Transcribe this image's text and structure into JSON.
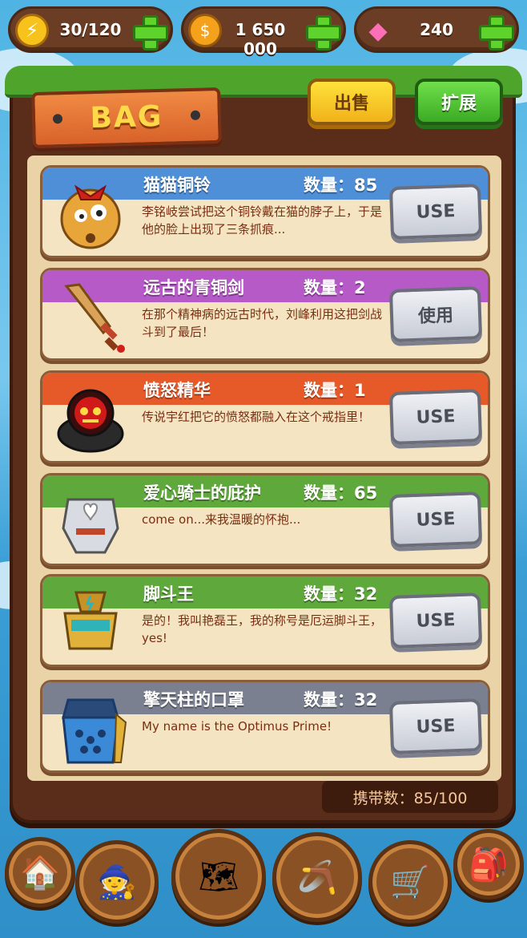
{
  "resources": {
    "energy": {
      "icon": "lightning-icon",
      "value": "30/120",
      "color": "#f7c21c"
    },
    "coins": {
      "icon": "coin-icon",
      "value": "1 650 000",
      "color": "#f4a21c"
    },
    "gems": {
      "icon": "gem-icon",
      "value": "240",
      "color": "#ff6fb8"
    }
  },
  "bag": {
    "title": "BAG",
    "sell_label": "出售",
    "expand_label": "扩展",
    "carry_label": "携带数：85/100"
  },
  "items": [
    {
      "name": "猫猫铜铃",
      "qty": "数量：85",
      "desc": "李铭岐尝试把这个铜铃戴在猫的脖子上，于是他的脸上出现了三条抓痕...",
      "button": "USE",
      "band_color": "#4e8fd8",
      "icon": "cat-bell-icon"
    },
    {
      "name": "远古的青铜剑",
      "qty": "数量：2",
      "desc": "在那个精神病的远古时代，刘峰利用这把剑战斗到了最后！",
      "button": "使用",
      "band_color": "#b65ac8",
      "icon": "bronze-sword-icon"
    },
    {
      "name": "愤怒精华",
      "qty": "数量：1",
      "desc": "传说宇红把它的愤怒都融入在这个戒指里！",
      "button": "USE",
      "band_color": "#e65a2a",
      "icon": "rage-ring-icon"
    },
    {
      "name": "爱心骑士的庇护",
      "qty": "数量：65",
      "desc": "come on...来我温暖的怀抱...",
      "button": "USE",
      "band_color": "#5fa83c",
      "icon": "knight-armor-icon"
    },
    {
      "name": "脚斗王",
      "qty": "数量：32",
      "desc": "是的！我叫艳磊王，我的称号是厄运脚斗王，yes!",
      "button": "USE",
      "band_color": "#5fa83c",
      "icon": "golden-armor-icon"
    },
    {
      "name": "擎天柱的口罩",
      "qty": "数量：32",
      "desc": "My name is the Optimus Prime!",
      "button": "USE",
      "band_color": "#7a8090",
      "icon": "optimus-mask-icon"
    }
  ],
  "nav": [
    {
      "name": "house-icon",
      "glyph": "🏠"
    },
    {
      "name": "wizard-hat-icon",
      "glyph": "🧙"
    },
    {
      "name": "treasure-map-icon",
      "glyph": "🗺"
    },
    {
      "name": "slingshot-icon",
      "glyph": "🪃"
    },
    {
      "name": "shopping-cart-icon",
      "glyph": "🛒"
    },
    {
      "name": "backpack-icon",
      "glyph": "🎒"
    }
  ]
}
